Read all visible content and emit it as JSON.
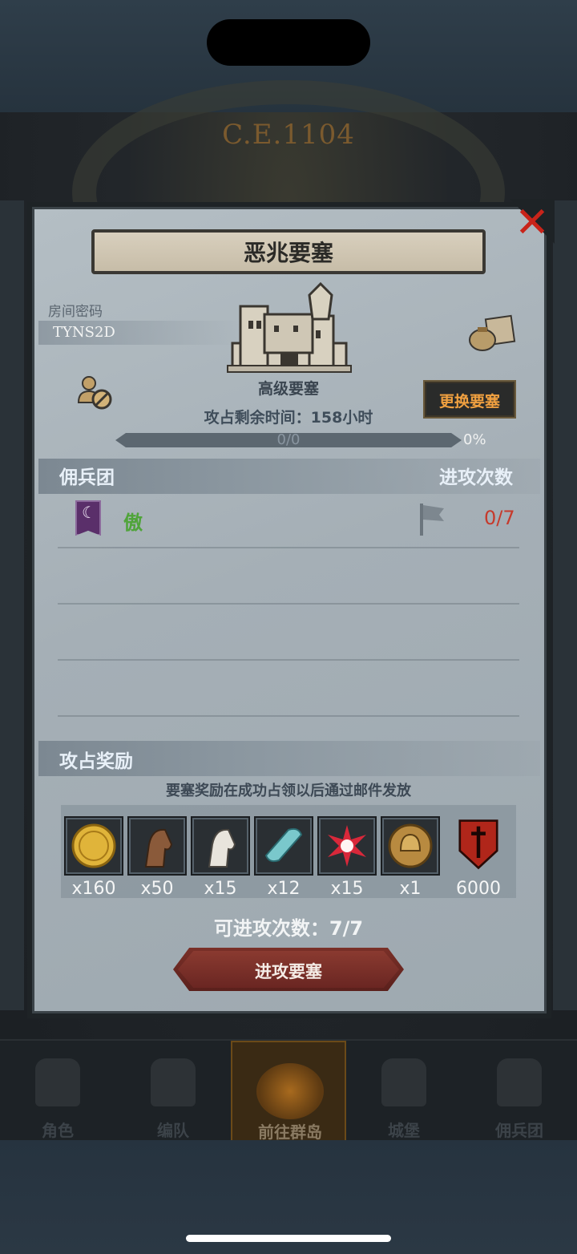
{
  "game": {
    "era": "C.E.1104"
  },
  "modal": {
    "title": "恶兆要塞",
    "room_password_label": "房间密码",
    "room_password": "TYNS2D",
    "fortress_level": "高级要塞",
    "change_fortress_label": "更换要塞",
    "remaining_time": "攻占剩余时间：158小时",
    "progress_text": "0/0",
    "progress_percent": "0%",
    "progress_fraction": 0
  },
  "mercenary": {
    "section_title": "佣兵团",
    "attack_count_title": "进攻次数",
    "guild_name": "傲",
    "attempts": "0/7"
  },
  "rewards": {
    "section_title": "攻占奖励",
    "note": "要塞奖励在成功占领以后通过邮件发放",
    "items": [
      {
        "icon": "gold-coin-icon",
        "qty": "x160"
      },
      {
        "icon": "brown-horse-icon",
        "qty": "x50"
      },
      {
        "icon": "white-horse-icon",
        "qty": "x15"
      },
      {
        "icon": "cloth-icon",
        "qty": "x12"
      },
      {
        "icon": "star-burst-icon",
        "qty": "x15"
      },
      {
        "icon": "helmet-medal-icon",
        "qty": "x1"
      },
      {
        "icon": "red-shield-icon",
        "qty": "6000"
      }
    ]
  },
  "remaining_attacks": "可进攻次数：7/7",
  "attack_button_label": "进攻要塞",
  "nav": [
    {
      "label": "角色"
    },
    {
      "label": "编队"
    },
    {
      "label": "前往群岛",
      "active": true
    },
    {
      "label": "城堡"
    },
    {
      "label": "佣兵团"
    }
  ],
  "colors": {
    "accent_orange": "#f0a040",
    "attempts_red": "#c63a2c",
    "guild_green": "#4fa43a"
  }
}
